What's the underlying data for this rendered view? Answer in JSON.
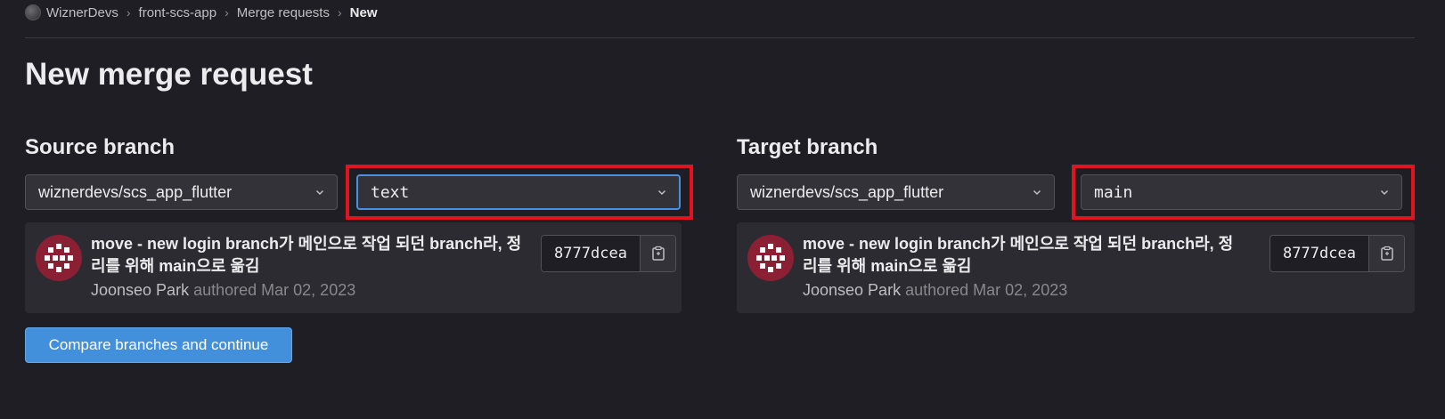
{
  "breadcrumb": {
    "items": [
      "WiznerDevs",
      "front-scs-app",
      "Merge requests"
    ],
    "current": "New",
    "separator": "›"
  },
  "page": {
    "title": "New merge request"
  },
  "source": {
    "label": "Source branch",
    "project": "wiznerdevs/scs_app_flutter",
    "branch": "text",
    "commit": {
      "title": "move - new login branch가 메인으로 작업 되던 branch라, 정리를 위해 main으로 옮김",
      "author": "Joonseo Park",
      "authored_text": "authored Mar 02, 2023",
      "sha": "8777dcea"
    }
  },
  "target": {
    "label": "Target branch",
    "project": "wiznerdevs/scs_app_flutter",
    "branch": "main",
    "commit": {
      "title": "move - new login branch가 메인으로 작업 되던 branch라, 정리를 위해 main으로 옮김",
      "author": "Joonseo Park",
      "authored_text": "authored Mar 02, 2023",
      "sha": "8777dcea"
    }
  },
  "actions": {
    "compare_label": "Compare branches and continue"
  },
  "colors": {
    "background": "#1f1e24",
    "accent": "#428fdc",
    "highlight": "#e0141e",
    "avatar": "#8b2035"
  },
  "icons": [
    "chevron-down-icon",
    "copy-icon",
    "identicon-avatar",
    "group-avatar"
  ]
}
